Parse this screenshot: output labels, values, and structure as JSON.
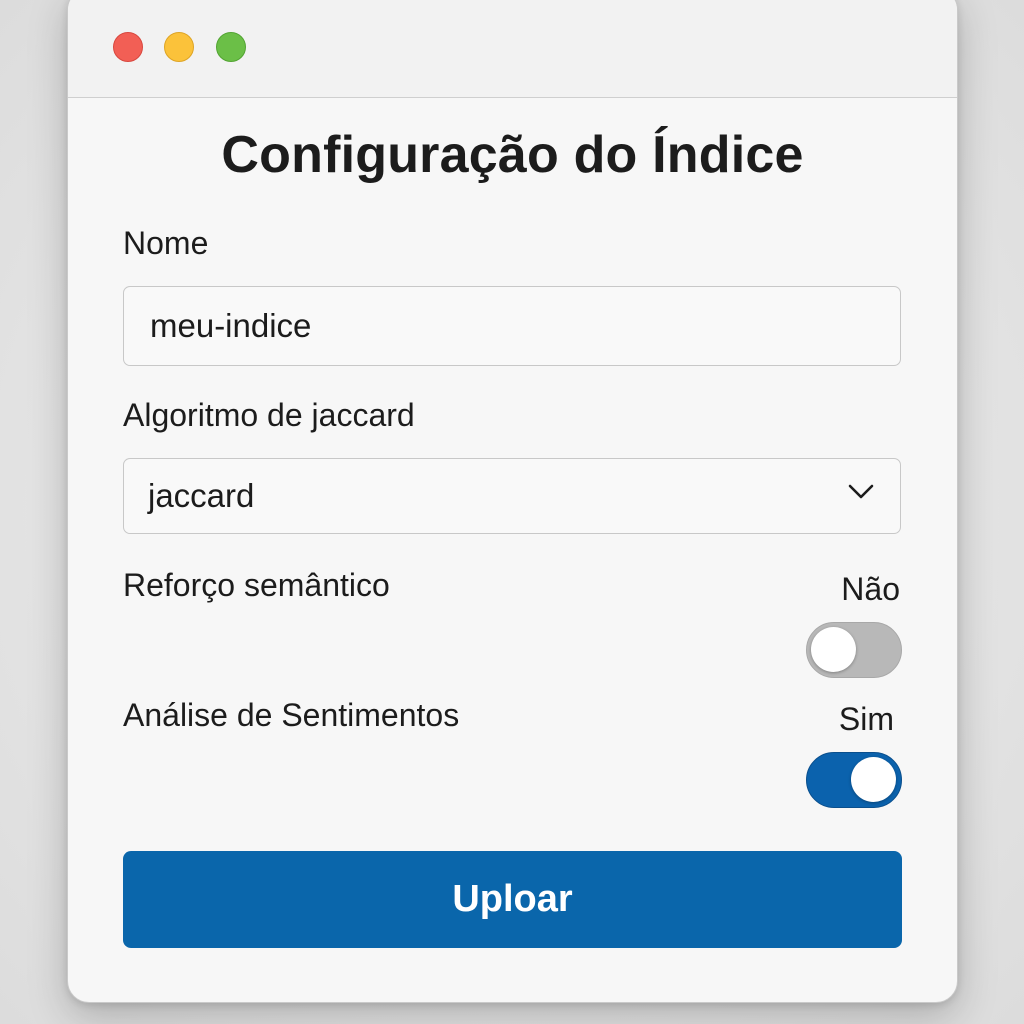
{
  "window": {
    "controls": {
      "close": "close-button",
      "minimize": "minimize-button",
      "maximize": "maximize-button"
    }
  },
  "form": {
    "title": "Configuração do Índice",
    "name": {
      "label": "Nome",
      "value": "meu-indice"
    },
    "algorithm": {
      "label": "Algoritmo de jaccard",
      "selected": "jaccard"
    },
    "semantic_boost": {
      "label": "Reforço semântico",
      "state_label": "Não",
      "enabled": false
    },
    "sentiment_analysis": {
      "label": "Análise de Sentimentos",
      "state_label": "Sim",
      "enabled": true
    },
    "submit_label": "Uploar"
  },
  "colors": {
    "accent": "#0a66ab",
    "toggle_off": "#b8b8b8",
    "close": "#f25f55",
    "minimize": "#fbc23a",
    "maximize": "#6bbf47"
  }
}
